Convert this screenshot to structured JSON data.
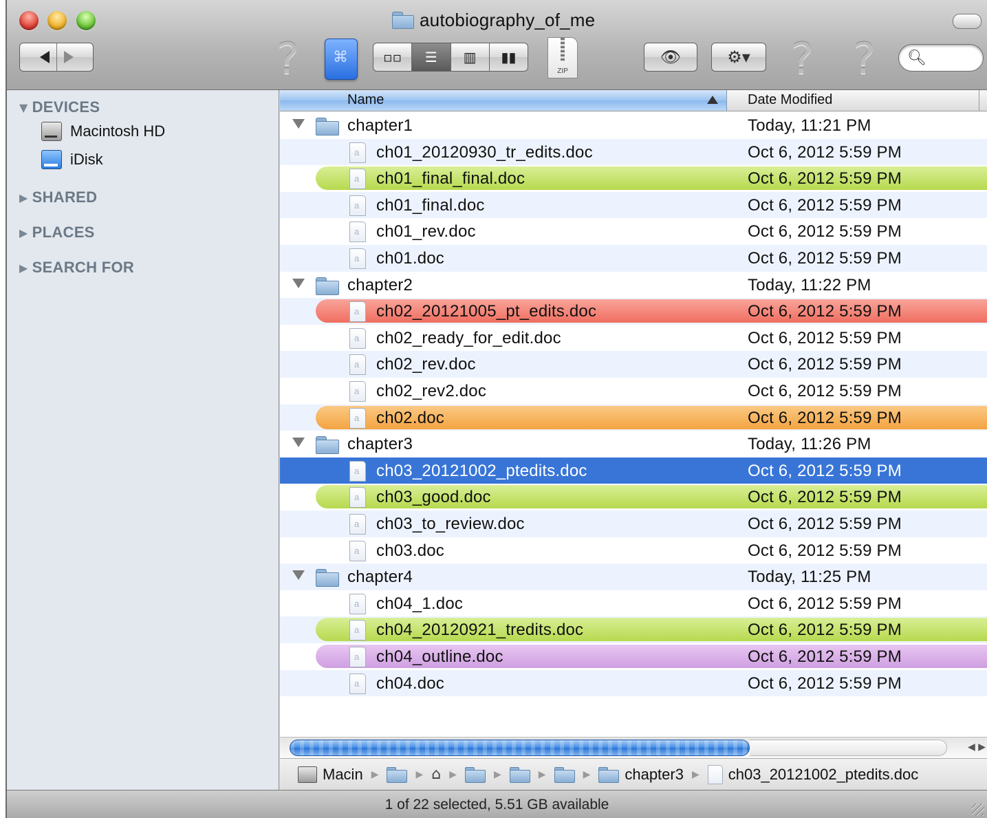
{
  "window": {
    "title": "autobiography_of_me"
  },
  "toolbar": {
    "back_icon": "back-arrow-icon",
    "forward_icon": "forward-arrow-icon",
    "help_glyph": "?",
    "view_modes": [
      "icon",
      "list",
      "column",
      "cover-flow"
    ],
    "active_view": "list",
    "zip_label": "ZIP",
    "search_placeholder": ""
  },
  "sidebar": {
    "sections": {
      "devices": "DEVICES",
      "shared": "SHARED",
      "places": "PLACES",
      "search_for": "SEARCH FOR"
    },
    "devices": [
      {
        "label": "Macintosh HD",
        "icon": "hard-drive-icon"
      },
      {
        "label": "iDisk",
        "icon": "idisk-icon"
      }
    ]
  },
  "columns": {
    "name": "Name",
    "date_modified": "Date Modified"
  },
  "label_colors": {
    "green": "#b6d94e",
    "red": "#ef6e60",
    "orange": "#f3a441",
    "purple": "#cf9fe1",
    "selection": "#3875d7"
  },
  "rows": [
    {
      "name": "chapter1",
      "date": "Today, 11:21 PM",
      "folder": true
    },
    {
      "name": "ch01_20120930_tr_edits.doc",
      "date": "Oct 6, 2012 5:59 PM"
    },
    {
      "name": "ch01_final_final.doc",
      "date": "Oct 6, 2012 5:59 PM",
      "label": "green"
    },
    {
      "name": "ch01_final.doc",
      "date": "Oct 6, 2012 5:59 PM"
    },
    {
      "name": "ch01_rev.doc",
      "date": "Oct 6, 2012 5:59 PM"
    },
    {
      "name": "ch01.doc",
      "date": "Oct 6, 2012 5:59 PM"
    },
    {
      "name": "chapter2",
      "date": "Today, 11:22 PM",
      "folder": true
    },
    {
      "name": "ch02_20121005_pt_edits.doc",
      "date": "Oct 6, 2012 5:59 PM",
      "label": "red"
    },
    {
      "name": "ch02_ready_for_edit.doc",
      "date": "Oct 6, 2012 5:59 PM"
    },
    {
      "name": "ch02_rev.doc",
      "date": "Oct 6, 2012 5:59 PM"
    },
    {
      "name": "ch02_rev2.doc",
      "date": "Oct 6, 2012 5:59 PM"
    },
    {
      "name": "ch02.doc",
      "date": "Oct 6, 2012 5:59 PM",
      "label": "orange"
    },
    {
      "name": "chapter3",
      "date": "Today, 11:26 PM",
      "folder": true
    },
    {
      "name": "ch03_20121002_ptedits.doc",
      "date": "Oct 6, 2012 5:59 PM",
      "selected": true
    },
    {
      "name": "ch03_good.doc",
      "date": "Oct 6, 2012 5:59 PM",
      "label": "green"
    },
    {
      "name": "ch03_to_review.doc",
      "date": "Oct 6, 2012 5:59 PM"
    },
    {
      "name": "ch03.doc",
      "date": "Oct 6, 2012 5:59 PM"
    },
    {
      "name": "chapter4",
      "date": "Today, 11:25 PM",
      "folder": true
    },
    {
      "name": "ch04_1.doc",
      "date": "Oct 6, 2012 5:59 PM"
    },
    {
      "name": "ch04_20120921_tredits.doc",
      "date": "Oct 6, 2012 5:59 PM",
      "label": "green"
    },
    {
      "name": "ch04_outline.doc",
      "date": "Oct 6, 2012 5:59 PM",
      "label": "purple"
    },
    {
      "name": "ch04.doc",
      "date": "Oct 6, 2012 5:59 PM"
    }
  ],
  "horizontal_scroll_fraction": 0.7,
  "pathbar": {
    "drive": "Macin",
    "folder": "chapter3",
    "file": "ch03_20121002_ptedits.doc"
  },
  "status": {
    "text": "1 of 22 selected, 5.51 GB available"
  }
}
